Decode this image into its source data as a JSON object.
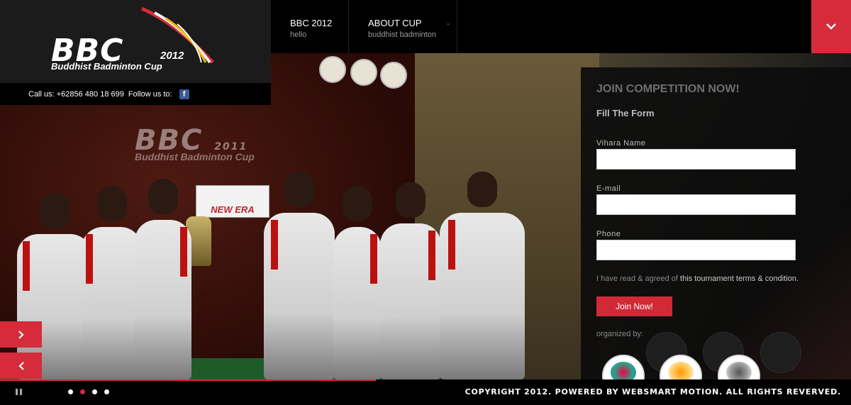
{
  "logo": {
    "main": "BBC",
    "year": "2012",
    "subtitle": "Buddhist Badminton Cup"
  },
  "contact": {
    "call_label": "Call us: +62856 480 18 699",
    "follow_label": "Follow us to:",
    "facebook_icon": "f"
  },
  "nav": {
    "items": [
      {
        "title": "BBC 2012",
        "subtitle": "hello"
      },
      {
        "title": "ABOUT CUP",
        "subtitle": "buddhist badminton"
      }
    ],
    "dash": "-"
  },
  "slide": {
    "backdrop_title": "BBC",
    "backdrop_year": "2011",
    "backdrop_subtitle": "Buddhist Badminton Cup",
    "banner": "NEW ERA"
  },
  "form": {
    "title": "JOIN COMPETITION NOW!",
    "subtitle": "Fill The Form",
    "fields": [
      {
        "label": "Vihara Name",
        "value": "",
        "placeholder": ""
      },
      {
        "label": "E-mail",
        "value": "",
        "placeholder": ""
      },
      {
        "label": "Phone",
        "value": "",
        "placeholder": ""
      }
    ],
    "terms_prefix": "I have read & agreed of ",
    "terms_link": "this tournament terms & condition.",
    "submit_label": "Join Now!",
    "organized_by": "organized by:"
  },
  "slider": {
    "total_slides": 4,
    "active_slide": 2
  },
  "footer": {
    "copyright": "COPYRIGHT 2012. POWERED BY WEBSMART MOTION. ALL RIGHTS REVERVED."
  },
  "colors": {
    "accent": "#d62b3a",
    "panel": "#1b1b1b"
  }
}
